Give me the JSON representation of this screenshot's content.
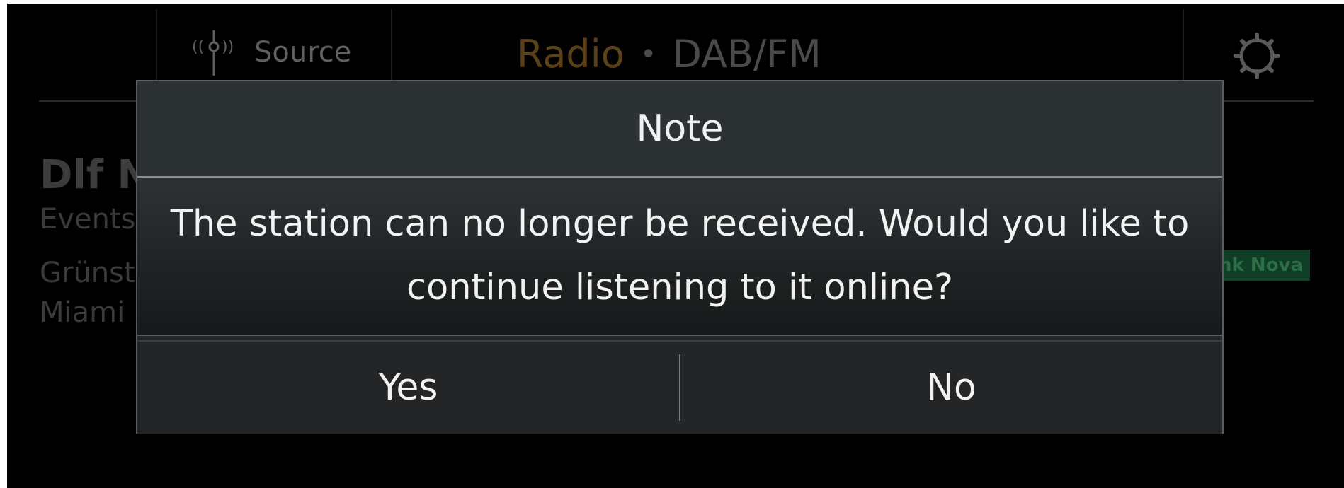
{
  "header": {
    "source_label": "Source",
    "title_source": "Radio",
    "title_separator": "•",
    "title_band": "DAB/FM",
    "source_icon": "antenna-icon",
    "settings_icon": "gear-icon"
  },
  "background": {
    "station_name": "Dlf N",
    "line1": "Events",
    "line2": "Grünst",
    "line3": "Miami",
    "badge": "nk Nova"
  },
  "dialog": {
    "title": "Note",
    "message": "The station can no longer be received. Would you like to continue listening to it online?",
    "yes_label": "Yes",
    "no_label": "No"
  },
  "colors": {
    "screen_bg": "#000000",
    "dialog_bg": "#232526",
    "dialog_header_bg": "#2c3133",
    "text": "#f2f2f2",
    "radio_accent": "#5a4118",
    "badge_bg": "#103d26"
  }
}
